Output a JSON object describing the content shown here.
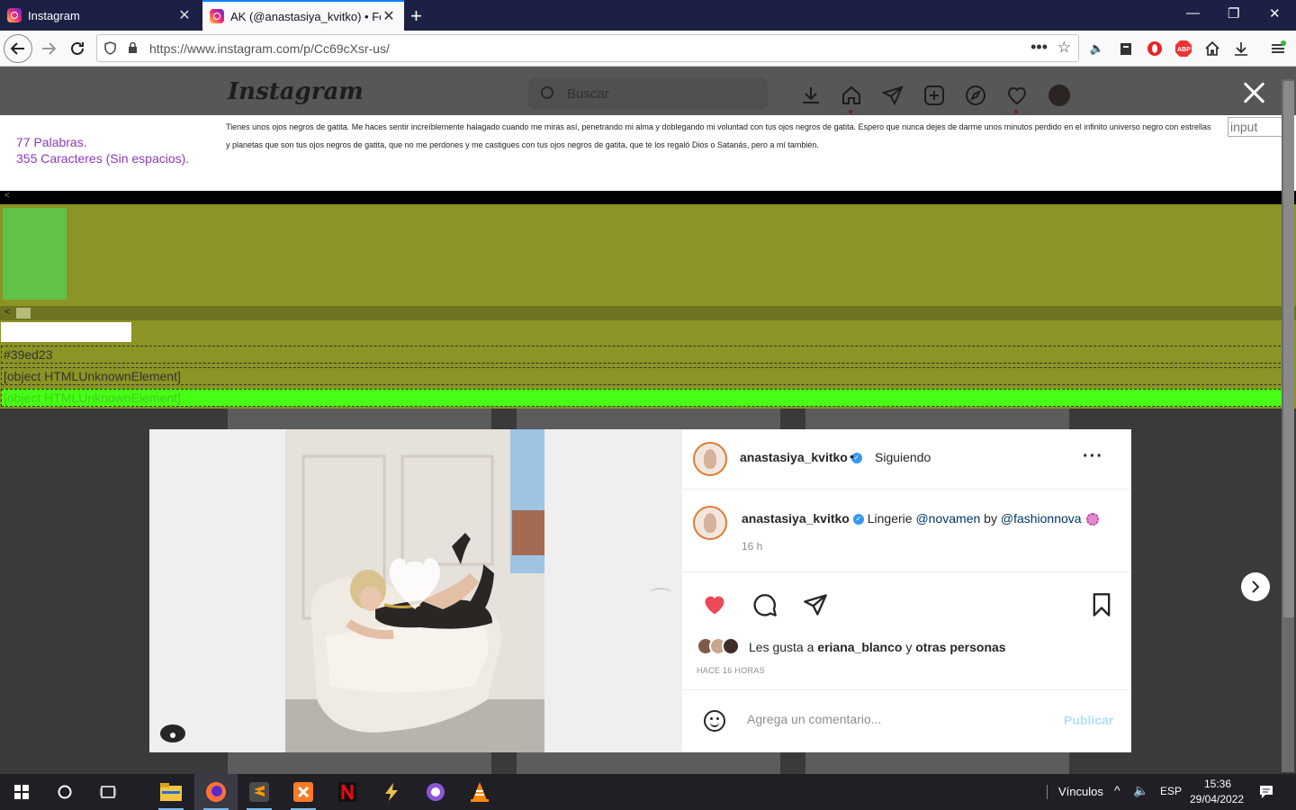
{
  "browser": {
    "tabs": [
      {
        "title": "Instagram",
        "active": false
      },
      {
        "title": "AK (@anastasiya_kvitko) • Foto",
        "active": true
      }
    ],
    "url": "https://www.instagram.com/p/Cc69cXsr-us/"
  },
  "instagram": {
    "logo": "Instagram",
    "search_placeholder": "Buscar",
    "nav_icons": [
      "download-icon",
      "home-icon",
      "direct-icon",
      "new-post-icon",
      "explore-icon",
      "activity-icon",
      "profile-avatar"
    ]
  },
  "word_counter": {
    "words": "77 Palabras.",
    "chars": "355 Caracteres (Sin espacios).",
    "text": "Tienes unos ojos negros de gatita. Me haces sentir increíblemente halagado cuando me miras así, penetrando mi alma y doblegando mi voluntad con tus ojos negros de gatita. Espero que nunca dejes de darme unos minutos perdido en el infinito universo negro con estrellas y planetas que son tus ojos negros de gatita, que no me perdones y me castigues con tus ojos negros de gatita, que te los regaló Dios o Satanás, pero a mí también.",
    "input_placeholder": "input"
  },
  "debug": {
    "color_hex": "#39ed23",
    "row1": "[object HTMLUnknownElement]",
    "row2": "[object HTMLUnknownElement]"
  },
  "post": {
    "username": "anastasiya_kvitko",
    "follow_state": "Siguiendo",
    "caption_prefix": "Lingerie",
    "mention1": "@novamen",
    "caption_by": "by",
    "mention2": "@fashionnova",
    "posted_ago": "16 h",
    "liked_prefix": "Les gusta a",
    "liked_user": "eriana_blanco",
    "liked_joiner": "y",
    "liked_others": "otras personas",
    "date_label": "HACE 16 HORAS",
    "comment_placeholder": "Agrega un comentario...",
    "publish_label": "Publicar",
    "liked": true
  },
  "taskbar": {
    "links_label": "Vínculos",
    "lang": "ESP",
    "time": "15:36",
    "date": "29/04/2022"
  },
  "colors": {
    "olive": "#8b9424",
    "lime": "#47ff14",
    "like_red": "#ed4956",
    "counter_purple": "#8a3bb7"
  }
}
